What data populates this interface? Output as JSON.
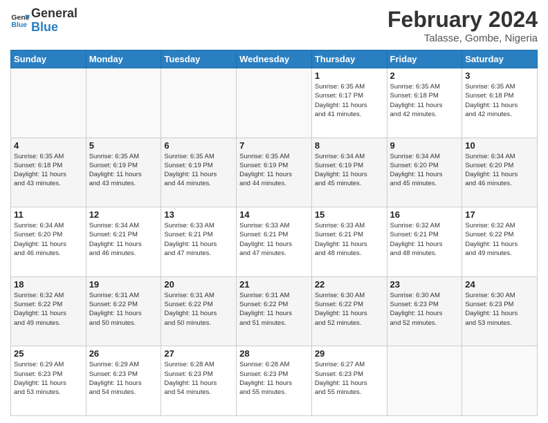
{
  "header": {
    "logo_line1": "General",
    "logo_line2": "Blue",
    "month_year": "February 2024",
    "location": "Talasse, Gombe, Nigeria"
  },
  "weekdays": [
    "Sunday",
    "Monday",
    "Tuesday",
    "Wednesday",
    "Thursday",
    "Friday",
    "Saturday"
  ],
  "weeks": [
    [
      {
        "day": "",
        "info": ""
      },
      {
        "day": "",
        "info": ""
      },
      {
        "day": "",
        "info": ""
      },
      {
        "day": "",
        "info": ""
      },
      {
        "day": "1",
        "info": "Sunrise: 6:35 AM\nSunset: 6:17 PM\nDaylight: 11 hours\nand 41 minutes."
      },
      {
        "day": "2",
        "info": "Sunrise: 6:35 AM\nSunset: 6:18 PM\nDaylight: 11 hours\nand 42 minutes."
      },
      {
        "day": "3",
        "info": "Sunrise: 6:35 AM\nSunset: 6:18 PM\nDaylight: 11 hours\nand 42 minutes."
      }
    ],
    [
      {
        "day": "4",
        "info": "Sunrise: 6:35 AM\nSunset: 6:18 PM\nDaylight: 11 hours\nand 43 minutes."
      },
      {
        "day": "5",
        "info": "Sunrise: 6:35 AM\nSunset: 6:19 PM\nDaylight: 11 hours\nand 43 minutes."
      },
      {
        "day": "6",
        "info": "Sunrise: 6:35 AM\nSunset: 6:19 PM\nDaylight: 11 hours\nand 44 minutes."
      },
      {
        "day": "7",
        "info": "Sunrise: 6:35 AM\nSunset: 6:19 PM\nDaylight: 11 hours\nand 44 minutes."
      },
      {
        "day": "8",
        "info": "Sunrise: 6:34 AM\nSunset: 6:19 PM\nDaylight: 11 hours\nand 45 minutes."
      },
      {
        "day": "9",
        "info": "Sunrise: 6:34 AM\nSunset: 6:20 PM\nDaylight: 11 hours\nand 45 minutes."
      },
      {
        "day": "10",
        "info": "Sunrise: 6:34 AM\nSunset: 6:20 PM\nDaylight: 11 hours\nand 46 minutes."
      }
    ],
    [
      {
        "day": "11",
        "info": "Sunrise: 6:34 AM\nSunset: 6:20 PM\nDaylight: 11 hours\nand 46 minutes."
      },
      {
        "day": "12",
        "info": "Sunrise: 6:34 AM\nSunset: 6:21 PM\nDaylight: 11 hours\nand 46 minutes."
      },
      {
        "day": "13",
        "info": "Sunrise: 6:33 AM\nSunset: 6:21 PM\nDaylight: 11 hours\nand 47 minutes."
      },
      {
        "day": "14",
        "info": "Sunrise: 6:33 AM\nSunset: 6:21 PM\nDaylight: 11 hours\nand 47 minutes."
      },
      {
        "day": "15",
        "info": "Sunrise: 6:33 AM\nSunset: 6:21 PM\nDaylight: 11 hours\nand 48 minutes."
      },
      {
        "day": "16",
        "info": "Sunrise: 6:32 AM\nSunset: 6:21 PM\nDaylight: 11 hours\nand 48 minutes."
      },
      {
        "day": "17",
        "info": "Sunrise: 6:32 AM\nSunset: 6:22 PM\nDaylight: 11 hours\nand 49 minutes."
      }
    ],
    [
      {
        "day": "18",
        "info": "Sunrise: 6:32 AM\nSunset: 6:22 PM\nDaylight: 11 hours\nand 49 minutes."
      },
      {
        "day": "19",
        "info": "Sunrise: 6:31 AM\nSunset: 6:22 PM\nDaylight: 11 hours\nand 50 minutes."
      },
      {
        "day": "20",
        "info": "Sunrise: 6:31 AM\nSunset: 6:22 PM\nDaylight: 11 hours\nand 50 minutes."
      },
      {
        "day": "21",
        "info": "Sunrise: 6:31 AM\nSunset: 6:22 PM\nDaylight: 11 hours\nand 51 minutes."
      },
      {
        "day": "22",
        "info": "Sunrise: 6:30 AM\nSunset: 6:22 PM\nDaylight: 11 hours\nand 52 minutes."
      },
      {
        "day": "23",
        "info": "Sunrise: 6:30 AM\nSunset: 6:23 PM\nDaylight: 11 hours\nand 52 minutes."
      },
      {
        "day": "24",
        "info": "Sunrise: 6:30 AM\nSunset: 6:23 PM\nDaylight: 11 hours\nand 53 minutes."
      }
    ],
    [
      {
        "day": "25",
        "info": "Sunrise: 6:29 AM\nSunset: 6:23 PM\nDaylight: 11 hours\nand 53 minutes."
      },
      {
        "day": "26",
        "info": "Sunrise: 6:29 AM\nSunset: 6:23 PM\nDaylight: 11 hours\nand 54 minutes."
      },
      {
        "day": "27",
        "info": "Sunrise: 6:28 AM\nSunset: 6:23 PM\nDaylight: 11 hours\nand 54 minutes."
      },
      {
        "day": "28",
        "info": "Sunrise: 6:28 AM\nSunset: 6:23 PM\nDaylight: 11 hours\nand 55 minutes."
      },
      {
        "day": "29",
        "info": "Sunrise: 6:27 AM\nSunset: 6:23 PM\nDaylight: 11 hours\nand 55 minutes."
      },
      {
        "day": "",
        "info": ""
      },
      {
        "day": "",
        "info": ""
      }
    ]
  ]
}
